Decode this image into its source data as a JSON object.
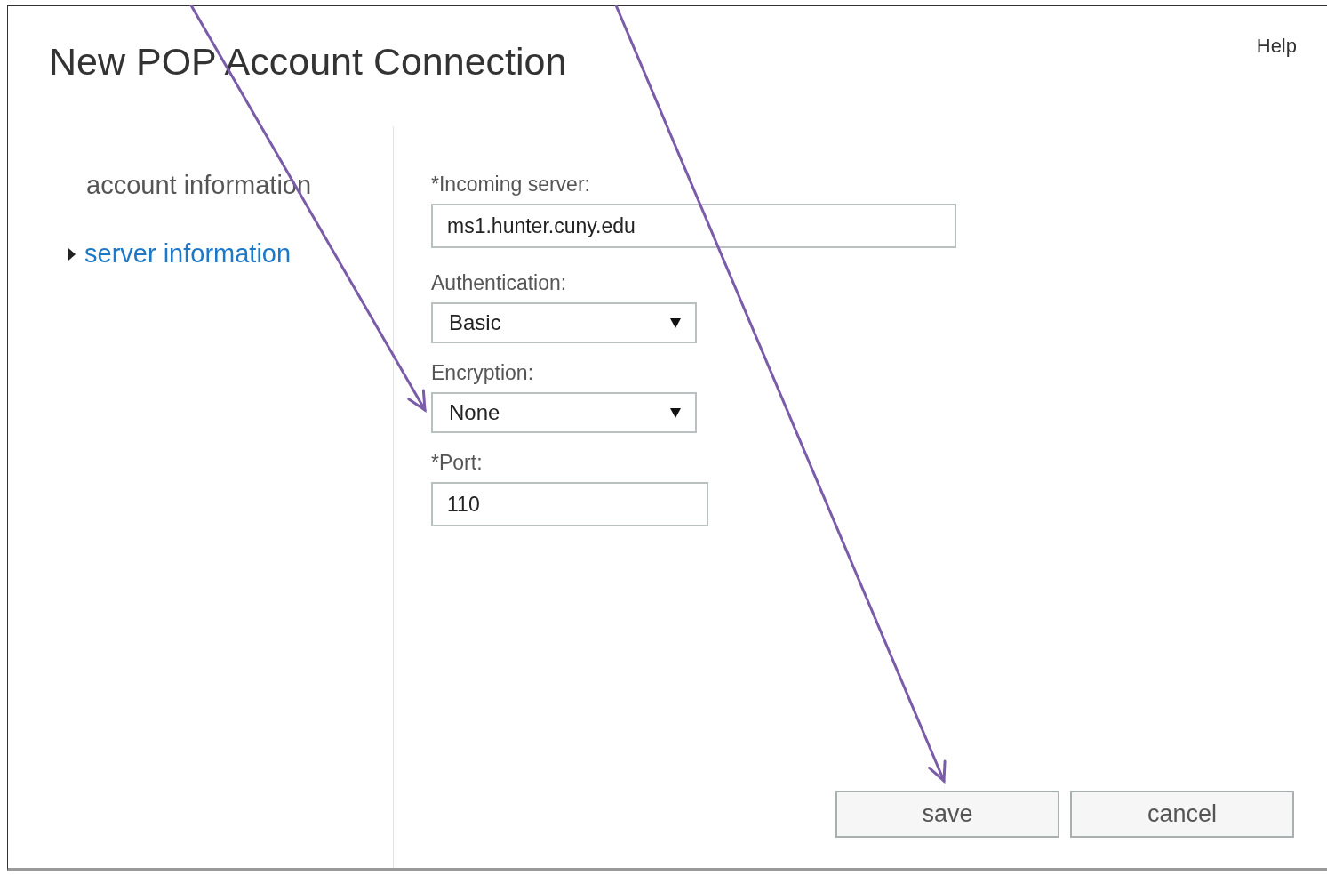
{
  "dialog": {
    "title": "New POP Account Connection",
    "help": "Help"
  },
  "nav": [
    {
      "label": "account information",
      "selected": false
    },
    {
      "label": "server information",
      "selected": true
    }
  ],
  "fields": [
    {
      "kind": "text",
      "label": "*Incoming server:",
      "value": "ms1.hunter.cuny.edu"
    },
    {
      "kind": "select",
      "label": "Authentication:",
      "value": "Basic"
    },
    {
      "kind": "select",
      "label": "Encryption:",
      "value": "None"
    },
    {
      "kind": "text",
      "label": "*Port:",
      "value": "110"
    }
  ],
  "buttons": [
    "save",
    "cancel"
  ],
  "annotations": [
    {
      "kind": "arrow"
    },
    {
      "kind": "arrow"
    }
  ]
}
